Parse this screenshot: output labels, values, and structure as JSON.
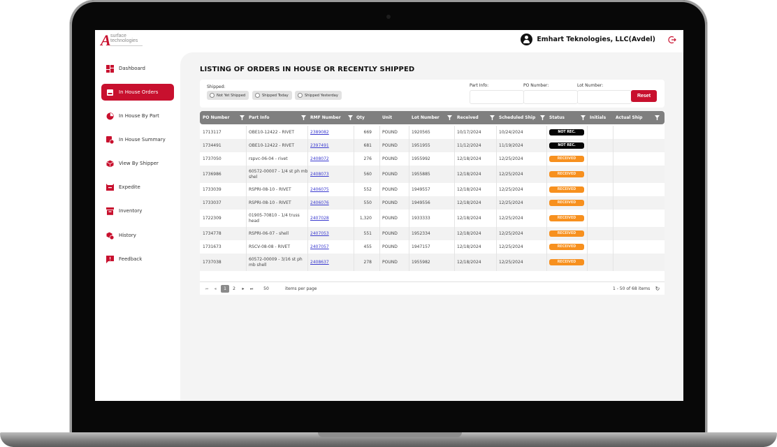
{
  "header": {
    "logo_text_line1": "surface",
    "logo_text_line2": "technologies",
    "logo_mark": "A",
    "user_name": "Emhart Teknologies, LLC(Avdel)",
    "user_icon": "user-circle-icon",
    "logout_icon": "logout-icon"
  },
  "sidebar": {
    "items": [
      {
        "label": "Dashboard",
        "icon": "dashboard-icon",
        "active": false
      },
      {
        "label": "In House Orders",
        "icon": "orders-icon",
        "active": true
      },
      {
        "label": "In House By Part",
        "icon": "pie-chart-icon",
        "active": false
      },
      {
        "label": "In House Summary",
        "icon": "summary-clock-icon",
        "active": false
      },
      {
        "label": "View By Shipper",
        "icon": "box-icon",
        "active": false
      },
      {
        "label": "Expedite",
        "icon": "expedite-bin-icon",
        "active": false
      },
      {
        "label": "Inventory",
        "icon": "archive-icon",
        "active": false
      },
      {
        "label": "History",
        "icon": "history-box-icon",
        "active": false
      },
      {
        "label": "Feedback",
        "icon": "feedback-icon",
        "active": false
      }
    ],
    "collapse_glyph": "‹"
  },
  "page": {
    "title": "LISTING OF ORDERS IN HOUSE OR RECENTLY SHIPPED"
  },
  "filters": {
    "shipped_label": "Shipped:",
    "shipped_options": [
      "Not Yet Shipped",
      "Shipped Today",
      "Shipped Yesterday"
    ],
    "part_info_label": "Part Info:",
    "part_info_value": "",
    "po_number_label": "PO Number:",
    "po_number_value": "",
    "lot_number_label": "Lot Number:",
    "lot_number_value": "",
    "reset_label": "Reset"
  },
  "table": {
    "columns": [
      "PO Number",
      "Part Info",
      "RMF Number",
      "Qty",
      "Unit",
      "Lot Number",
      "Received",
      "Scheduled Ship",
      "Status",
      "Initials",
      "Actual Ship"
    ],
    "rows": [
      {
        "po": "1713117",
        "part": "OBE10-12422 - RIVET",
        "rmf": "2389082",
        "qty": "669",
        "unit": "POUND",
        "lot": "1920565",
        "received": "10/17/2024",
        "sched": "10/24/2024",
        "status": "NOT REC.",
        "initials": "",
        "actual": ""
      },
      {
        "po": "1734491",
        "part": "OBE10-12422 - RIVET",
        "rmf": "2397491",
        "qty": "681",
        "unit": "POUND",
        "lot": "1951955",
        "received": "11/12/2024",
        "sched": "11/19/2024",
        "status": "NOT REC.",
        "initials": "",
        "actual": ""
      },
      {
        "po": "1737050",
        "part": "rspvc-06-04 - rivet",
        "rmf": "2408072",
        "qty": "276",
        "unit": "POUND",
        "lot": "1955992",
        "received": "12/18/2024",
        "sched": "12/25/2024",
        "status": "RECEIVED",
        "initials": "",
        "actual": ""
      },
      {
        "po": "1736986",
        "part": "60572-00007 - 1/4 st ph mb shel",
        "rmf": "2408073",
        "qty": "560",
        "unit": "POUND",
        "lot": "1955885",
        "received": "12/18/2024",
        "sched": "12/25/2024",
        "status": "RECEIVED",
        "initials": "",
        "actual": ""
      },
      {
        "po": "1733039",
        "part": "RSPRI-08-10 - RIVET",
        "rmf": "2406075",
        "qty": "552",
        "unit": "POUND",
        "lot": "1949557",
        "received": "12/18/2024",
        "sched": "12/25/2024",
        "status": "RECEIVED",
        "initials": "",
        "actual": ""
      },
      {
        "po": "1733037",
        "part": "RSPRI-08-10 - RIVET",
        "rmf": "2406076",
        "qty": "550",
        "unit": "POUND",
        "lot": "1949556",
        "received": "12/18/2024",
        "sched": "12/25/2024",
        "status": "RECEIVED",
        "initials": "",
        "actual": ""
      },
      {
        "po": "1722309",
        "part": "01905-70810 - 1/4 truss head",
        "rmf": "2407028",
        "qty": "1,320",
        "unit": "POUND",
        "lot": "1933333",
        "received": "12/18/2024",
        "sched": "12/25/2024",
        "status": "RECEIVED",
        "initials": "",
        "actual": ""
      },
      {
        "po": "1734778",
        "part": "RSPRI-06-07 - shell",
        "rmf": "2407053",
        "qty": "551",
        "unit": "POUND",
        "lot": "1952334",
        "received": "12/18/2024",
        "sched": "12/25/2024",
        "status": "RECEIVED",
        "initials": "",
        "actual": ""
      },
      {
        "po": "1731673",
        "part": "RSCV-08-08 - RIVET",
        "rmf": "2407057",
        "qty": "455",
        "unit": "POUND",
        "lot": "1947157",
        "received": "12/18/2024",
        "sched": "12/25/2024",
        "status": "RECEIVED",
        "initials": "",
        "actual": ""
      },
      {
        "po": "1737038",
        "part": "60572-00009 - 3/16 st ph mb shell",
        "rmf": "2408637",
        "qty": "278",
        "unit": "POUND",
        "lot": "1955982",
        "received": "12/18/2024",
        "sched": "12/25/2024",
        "status": "RECEIVED",
        "initials": "",
        "actual": ""
      }
    ]
  },
  "pager": {
    "first": "⏮",
    "prev": "◂",
    "pages": [
      "1",
      "2"
    ],
    "current_page": "1",
    "next": "▸",
    "last": "⏭",
    "page_size": "50",
    "page_size_label": "items per page",
    "summary": "1 - 50 of 68 items",
    "refresh_icon": "↻"
  },
  "colors": {
    "brand": "#c8102e",
    "header_bg": "#7f7f7f",
    "received": "#f7901e",
    "not_received": "#050505"
  }
}
